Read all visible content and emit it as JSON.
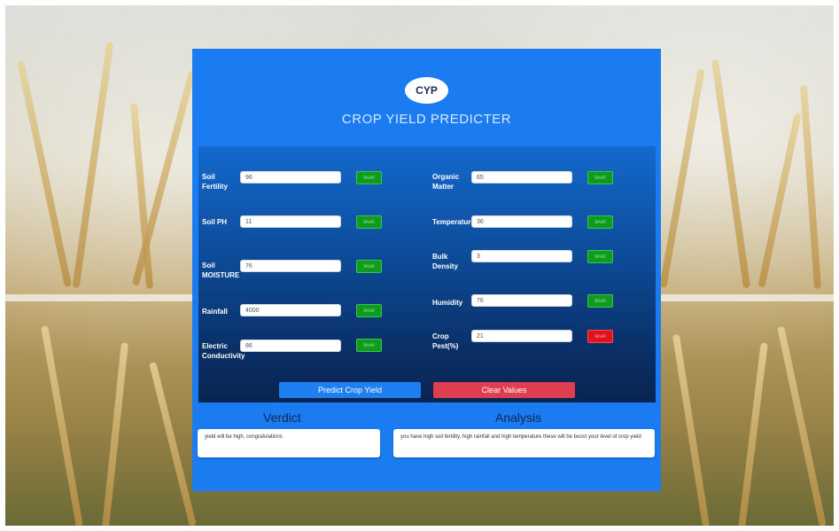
{
  "app": {
    "logo_text": "CYP",
    "title": "CROP YIELD PREDICTER"
  },
  "fields": [
    {
      "label": "Soil Fertility",
      "value": "96",
      "level": "level",
      "status": "green"
    },
    {
      "label": "Soil PH",
      "value": "11",
      "level": "level",
      "status": "green"
    },
    {
      "label": "Soil MOISTURE",
      "value": "76",
      "level": "level",
      "status": "green"
    },
    {
      "label": "Rainfall",
      "value": "4000",
      "level": "level",
      "status": "green"
    },
    {
      "label": "Electric Conductivity",
      "value": "86",
      "level": "level",
      "status": "green"
    },
    {
      "label": "Organic Matter",
      "value": "65",
      "level": "level",
      "status": "green"
    },
    {
      "label": "Temperature",
      "value": "36",
      "level": "level",
      "status": "green"
    },
    {
      "label": "Bulk Density",
      "value": "3",
      "level": "level",
      "status": "green"
    },
    {
      "label": "Humidity",
      "value": "76",
      "level": "level",
      "status": "green"
    },
    {
      "label": "Crop Pest(%)",
      "value": "21",
      "level": "level",
      "status": "red"
    }
  ],
  "buttons": {
    "predict": "Predict Crop Yield",
    "clear": "Clear Values"
  },
  "verdict": {
    "title": "Verdict",
    "text": "yield will be high. congratulations"
  },
  "analysis": {
    "title": "Analysis",
    "text": "you have high soil fertility, high rainfall and high temperature these will be boost your level of crop yield"
  },
  "colors": {
    "panel": "#1a7cf0",
    "good_level": "#0f9b1f",
    "bad_level": "#e0121f",
    "predict_button": "#1e7ff0",
    "clear_button": "#de3e4e"
  }
}
